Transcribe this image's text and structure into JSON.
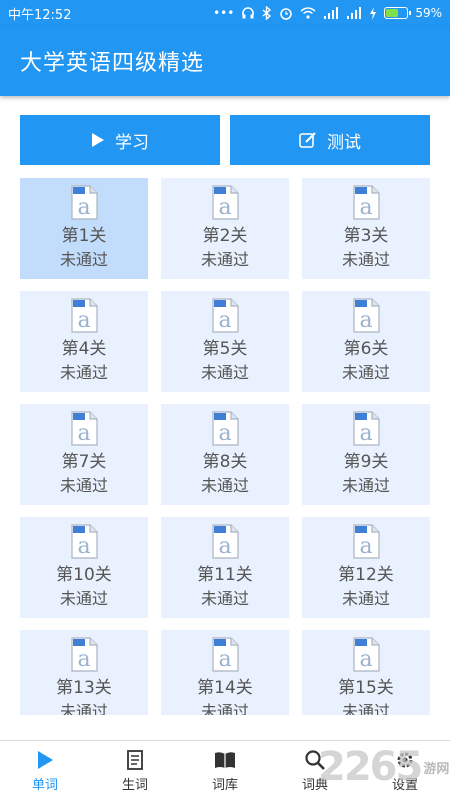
{
  "status": {
    "time": "中午12:52",
    "battery": "59%",
    "battery_level": 0.59
  },
  "app": {
    "title": "大学英语四级精选"
  },
  "modes": {
    "learn_label": "学习",
    "test_label": "测试"
  },
  "levels": [
    {
      "name": "第1关",
      "state": "未通过"
    },
    {
      "name": "第2关",
      "state": "未通过"
    },
    {
      "name": "第3关",
      "state": "未通过"
    },
    {
      "name": "第4关",
      "state": "未通过"
    },
    {
      "name": "第5关",
      "state": "未通过"
    },
    {
      "name": "第6关",
      "state": "未通过"
    },
    {
      "name": "第7关",
      "state": "未通过"
    },
    {
      "name": "第8关",
      "state": "未通过"
    },
    {
      "name": "第9关",
      "state": "未通过"
    },
    {
      "name": "第10关",
      "state": "未通过"
    },
    {
      "name": "第11关",
      "state": "未通过"
    },
    {
      "name": "第12关",
      "state": "未通过"
    },
    {
      "name": "第13关",
      "state": "未通过"
    },
    {
      "name": "第14关",
      "state": "未通过"
    },
    {
      "name": "第15关",
      "state": "未通过"
    }
  ],
  "nav": [
    {
      "label": "单词",
      "icon": "play-icon"
    },
    {
      "label": "生词",
      "icon": "notebook-icon"
    },
    {
      "label": "词库",
      "icon": "book-icon"
    },
    {
      "label": "词典",
      "icon": "search-icon"
    },
    {
      "label": "设置",
      "icon": "gear-icon"
    }
  ],
  "watermark": {
    "digits": "2265",
    "text": "游网"
  },
  "colors": {
    "primary": "#2196f3",
    "tile": "#e8f1fd",
    "tile_active": "#c2dcfb"
  }
}
